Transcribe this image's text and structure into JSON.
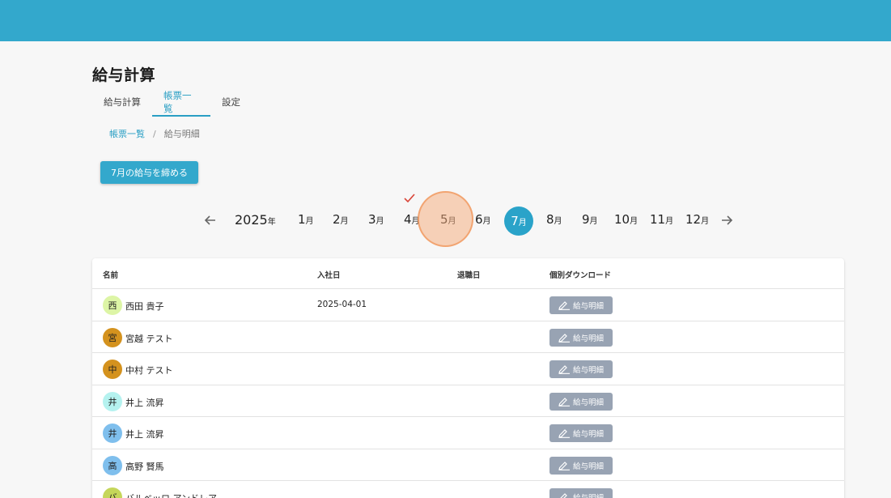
{
  "page": {
    "title": "給与計算"
  },
  "tabs": [
    {
      "label": "給与計算",
      "active": false
    },
    {
      "label": "帳票一覧",
      "active": true
    },
    {
      "label": "設定",
      "active": false
    }
  ],
  "breadcrumb": {
    "parent": "帳票一覧",
    "separator": "/",
    "current": "給与明細"
  },
  "close_button_label": "7月の給与を締める",
  "calendar": {
    "year": "2025",
    "year_suffix": "年",
    "month_suffix": "月",
    "months": [
      "1",
      "2",
      "3",
      "4",
      "5",
      "6",
      "7",
      "8",
      "9",
      "10",
      "11",
      "12"
    ],
    "selected_month": "7",
    "closed_months": [
      "4"
    ]
  },
  "table": {
    "headers": {
      "name": "名前",
      "joined": "入社日",
      "left": "退職日",
      "download": "個別ダウンロード"
    },
    "download_label": "給与明細",
    "rows": [
      {
        "initial": "西",
        "name": "西田 貴子",
        "joined": "2025-04-01",
        "left": "",
        "avatar_color": "#ddf5a6"
      },
      {
        "initial": "宮",
        "name": "宮越 テスト",
        "joined": "",
        "left": "",
        "avatar_color": "#d4921e"
      },
      {
        "initial": "中",
        "name": "中村 テスト",
        "joined": "",
        "left": "",
        "avatar_color": "#d4921e"
      },
      {
        "initial": "井",
        "name": "井上 流昇",
        "joined": "",
        "left": "",
        "avatar_color": "#b5f2ef"
      },
      {
        "initial": "井",
        "name": "井上 流昇",
        "joined": "",
        "left": "",
        "avatar_color": "#7fbfed"
      },
      {
        "initial": "高",
        "name": "高野 賢馬",
        "joined": "",
        "left": "",
        "avatar_color": "#7fbfed"
      },
      {
        "initial": "バ",
        "name": "バルベッロ アンドレア",
        "joined": "",
        "left": "",
        "avatar_color": "#c5d65a"
      }
    ]
  },
  "colors": {
    "header": "#33a8cc",
    "accent": "#2a9fc4",
    "download_button": "#98a3b3",
    "check": "#d9473a"
  },
  "icons": {
    "prev": "arrow-left-icon",
    "next": "arrow-right-icon",
    "closed": "check-icon",
    "download": "pencil-icon"
  }
}
